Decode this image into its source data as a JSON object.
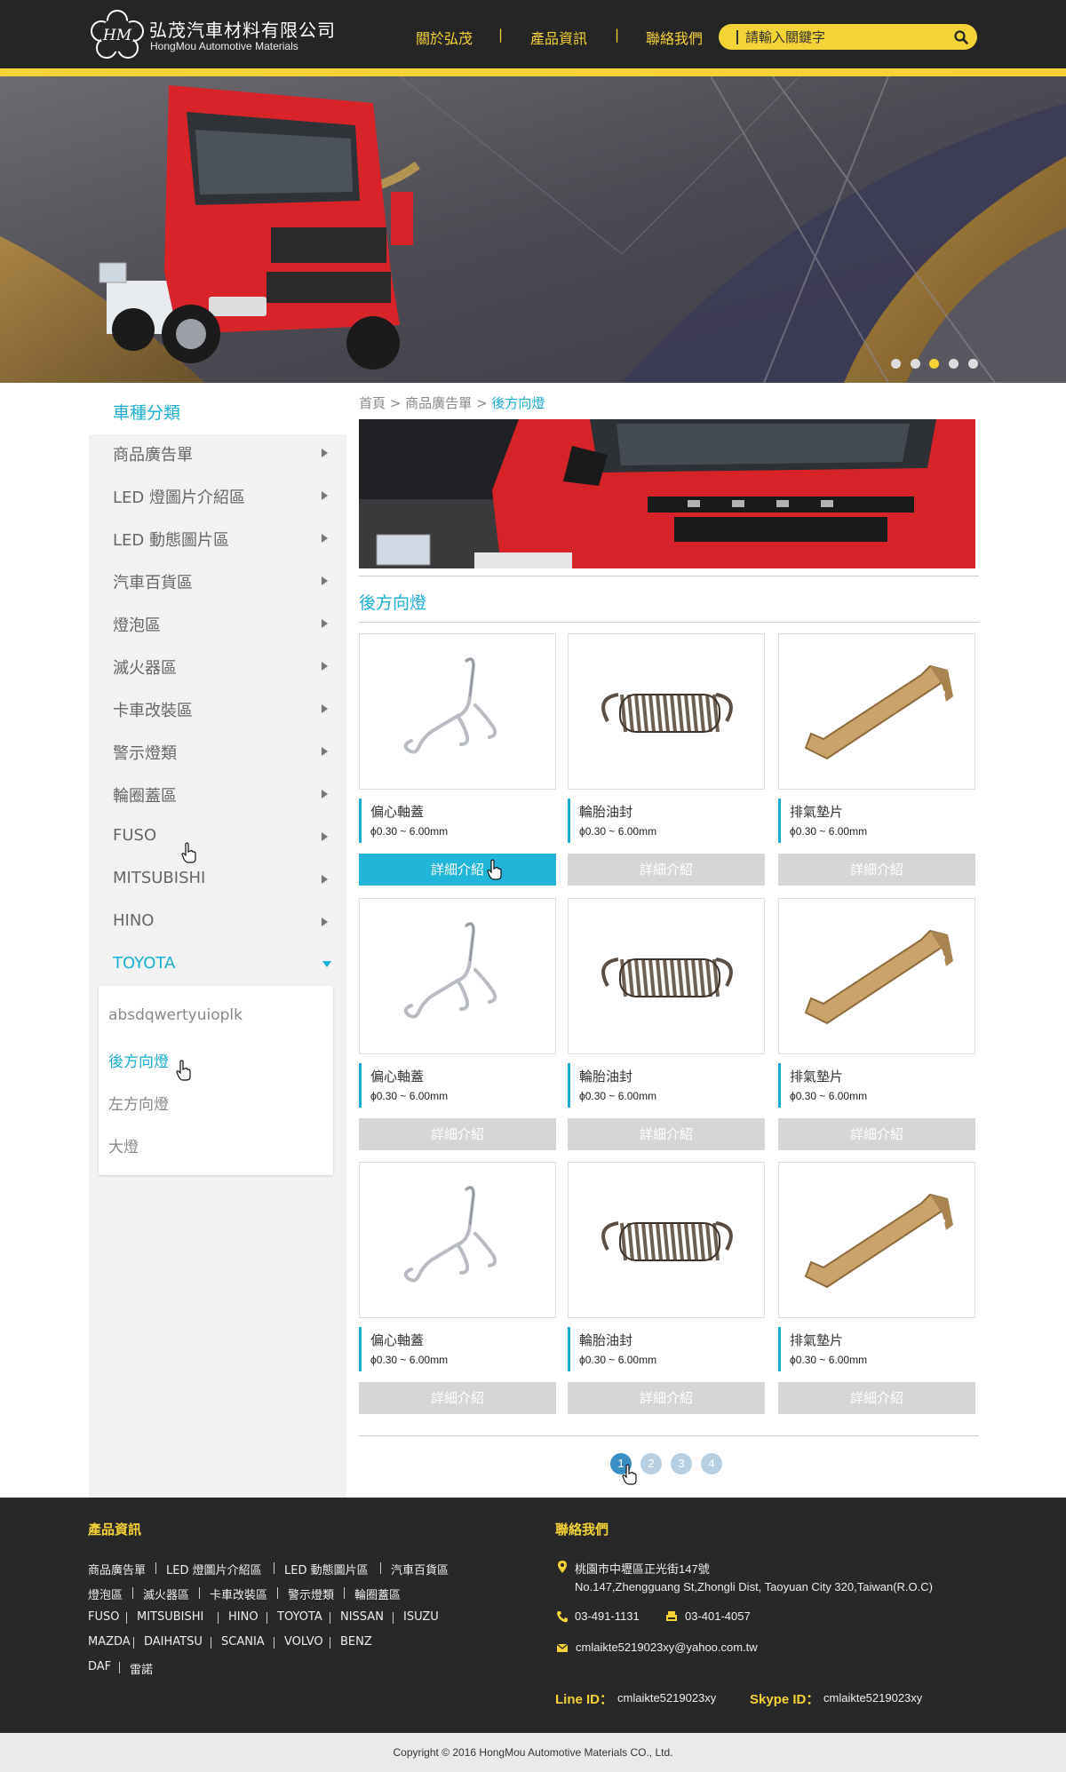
{
  "header": {
    "brand_zh": "弘茂汽車材料有限公司",
    "brand_en": "HongMou Automotive Materials",
    "logo_text": "HM",
    "nav": [
      "關於弘茂",
      "產品資訊",
      "聯絡我們"
    ],
    "nav_separator": "|",
    "search_placeholder": "請輸入關鍵字"
  },
  "banner": {
    "slide_count": 5,
    "active_slide": 3
  },
  "sidebar": {
    "title": "車種分類",
    "categories": [
      "商品廣告單",
      "LED 燈圖片介紹區",
      "LED 動態圖片區",
      "汽車百貨區",
      "燈泡區",
      "滅火器區",
      "卡車改裝區",
      "警示燈類",
      "輪圈蓋區",
      "FUSO",
      "MITSUBISHI",
      "HINO",
      "TOYOTA"
    ],
    "active_category": "TOYOTA",
    "submenu": [
      "absdqwertyuioplk",
      "後方向燈",
      "左方向燈",
      "大燈"
    ],
    "active_sub": "後方向燈"
  },
  "breadcrumb": {
    "home": "首頁",
    "sep": ">",
    "parent": "商品廣告單",
    "current": "後方向燈"
  },
  "section_title": "後方向燈",
  "products": [
    {
      "name": "偏心軸蓋",
      "spec": "ϕ0.30 ~ 6.00mm",
      "button": "詳細介紹",
      "icon": "wire-clip"
    },
    {
      "name": "輪胎油封",
      "spec": "ϕ0.30 ~ 6.00mm",
      "button": "詳細介紹",
      "icon": "coil-spring"
    },
    {
      "name": "排氣墊片",
      "spec": "ϕ0.30 ~ 6.00mm",
      "button": "詳細介紹",
      "icon": "brass-bracket"
    },
    {
      "name": "偏心軸蓋",
      "spec": "ϕ0.30 ~ 6.00mm",
      "button": "詳細介紹",
      "icon": "wire-clip"
    },
    {
      "name": "輪胎油封",
      "spec": "ϕ0.30 ~ 6.00mm",
      "button": "詳細介紹",
      "icon": "coil-spring"
    },
    {
      "name": "排氣墊片",
      "spec": "ϕ0.30 ~ 6.00mm",
      "button": "詳細介紹",
      "icon": "brass-bracket"
    },
    {
      "name": "偏心軸蓋",
      "spec": "ϕ0.30 ~ 6.00mm",
      "button": "詳細介紹",
      "icon": "wire-clip"
    },
    {
      "name": "輪胎油封",
      "spec": "ϕ0.30 ~ 6.00mm",
      "button": "詳細介紹",
      "icon": "coil-spring"
    },
    {
      "name": "排氣墊片",
      "spec": "ϕ0.30 ~ 6.00mm",
      "button": "詳細介紹",
      "icon": "brass-bracket"
    }
  ],
  "pagination": {
    "pages": [
      "1",
      "2",
      "3",
      "4"
    ],
    "current": "1"
  },
  "footer": {
    "products_title": "產品資訊",
    "product_links": [
      [
        "商品廣告單",
        "LED 燈圖片介紹區",
        "LED 動態圖片區",
        "汽車百貨區"
      ],
      [
        "燈泡區",
        "滅火器區",
        "卡車改裝區",
        "警示燈類",
        "輪圈蓋區"
      ],
      [
        "FUSO",
        "MITSUBISHI",
        "HINO",
        "TOYOTA",
        "NISSAN",
        "ISUZU"
      ],
      [
        "MAZDA",
        "DAIHATSU",
        "SCANIA",
        "VOLVO",
        "BENZ"
      ],
      [
        "DAF",
        "雷諾"
      ]
    ],
    "contact_title": "聯絡我們",
    "address_zh": "桃園市中壢區正光街147號",
    "address_en": "No.147,Zhengguang St,Zhongli Dist, Taoyuan City 320,Taiwan(R.O.C)",
    "phone": "03-491-1131",
    "fax": "03-401-4057",
    "email": "cmlaikte5219023xy@yahoo.com.tw",
    "line_label": "Line ID：",
    "line_id": "cmlaikte5219023xy",
    "skype_label": "Skype ID：",
    "skype_id": "cmlaikte5219023xy"
  },
  "copyright": "Copyright  ©  2016 HongMou Automotive Materials CO., Ltd.",
  "colors": {
    "accent": "#1aaed4",
    "brand_yellow": "#f4d337",
    "header_bg": "#252525"
  }
}
